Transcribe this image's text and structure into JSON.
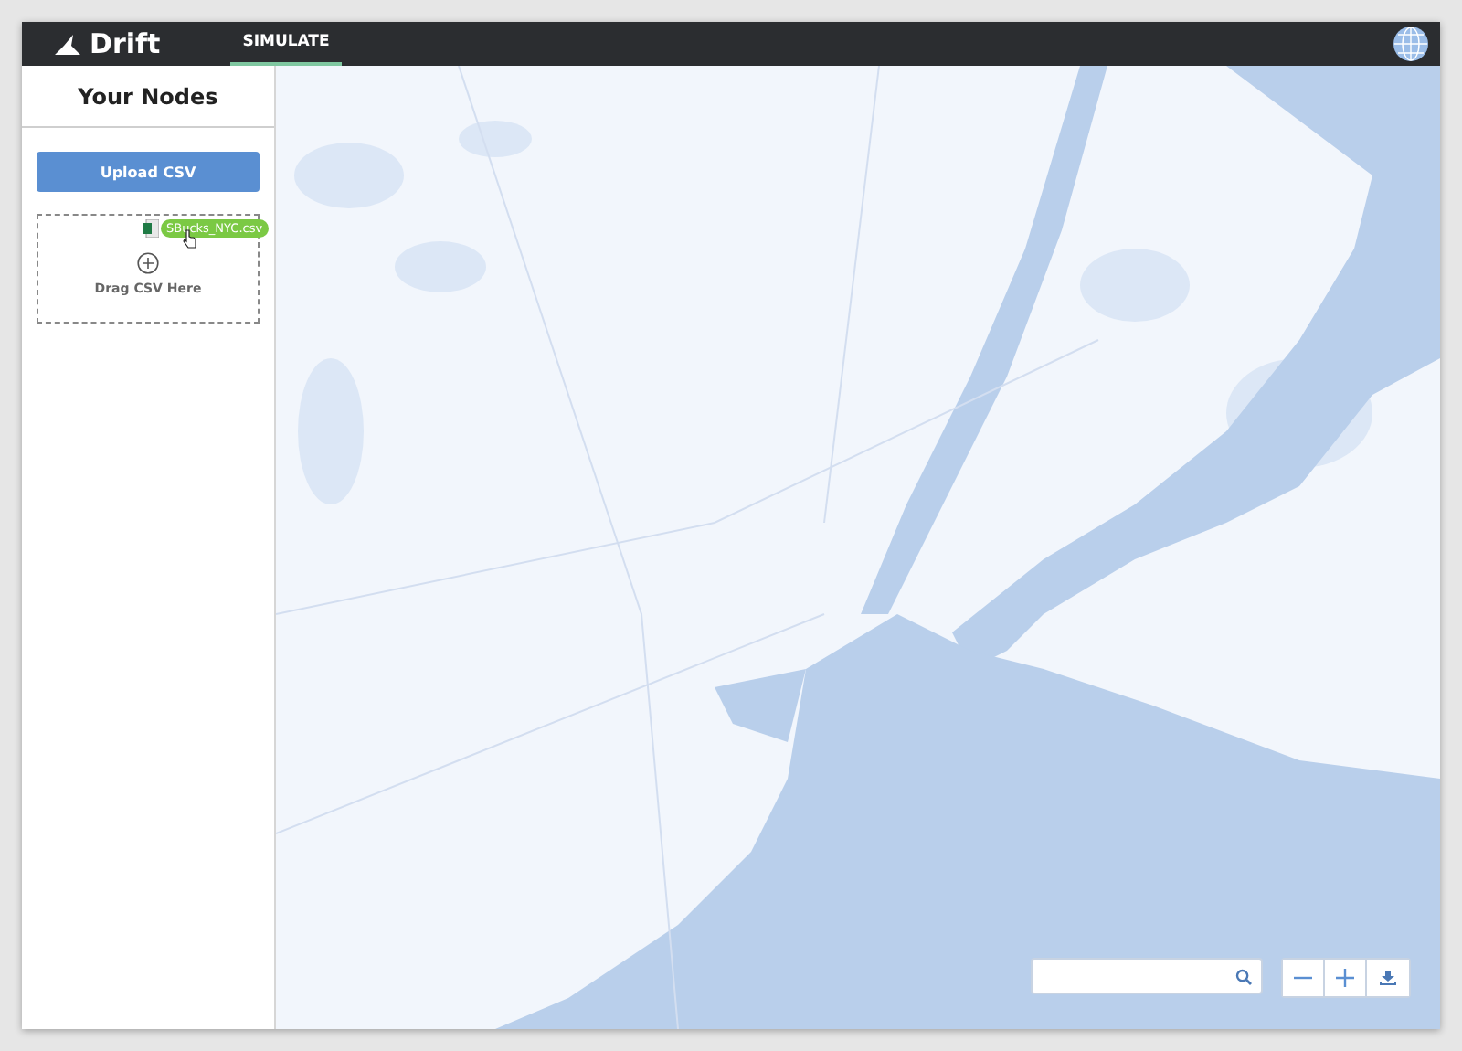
{
  "app": {
    "logo": "Drift"
  },
  "tabs": [
    {
      "label": "SIMULATE",
      "selected": true
    }
  ],
  "sidebar": {
    "title": "Your Nodes",
    "upload_button": "Upload CSV",
    "dropzone": {
      "label": "Drag CSV Here",
      "dragged_file": "SBucks_NYC.csv"
    }
  }
}
